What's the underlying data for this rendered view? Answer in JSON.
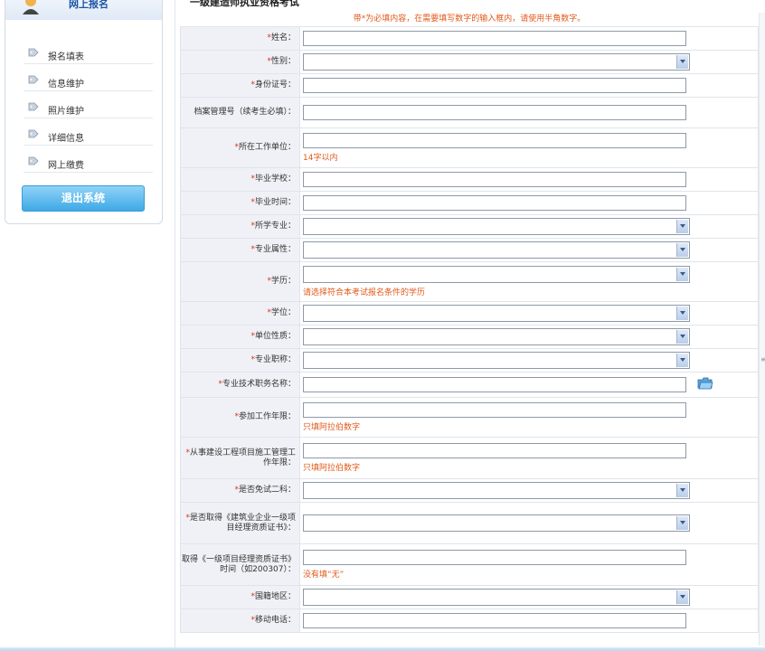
{
  "sidebar": {
    "title": "网上报名",
    "items": [
      {
        "label": "报名填表",
        "icon": "tag-icon"
      },
      {
        "label": "信息维护",
        "icon": "tag-icon"
      },
      {
        "label": "照片维护",
        "icon": "tag-icon"
      },
      {
        "label": "详细信息",
        "icon": "tag-icon"
      },
      {
        "label": "网上缴费",
        "icon": "tag-icon"
      }
    ],
    "logout_label": "退出系统"
  },
  "main": {
    "title": "一级建造师执业资格考试",
    "notice": "带*为必填内容，在需要填写数字的输入框内，请使用半角数字。"
  },
  "form": {
    "rows": [
      {
        "label": "姓名：",
        "required": true,
        "type": "text",
        "value": "",
        "hint": ""
      },
      {
        "label": "性别：",
        "required": true,
        "type": "select",
        "value": "",
        "hint": ""
      },
      {
        "label": "身份证号：",
        "required": true,
        "type": "text",
        "value": "",
        "hint": ""
      },
      {
        "label": "档案管理号（续考生必填）：",
        "required": false,
        "type": "text",
        "value": "",
        "hint": ""
      },
      {
        "label": "所在工作单位：",
        "required": true,
        "type": "text",
        "value": "",
        "hint": "14字以内"
      },
      {
        "label": "毕业学校：",
        "required": true,
        "type": "text",
        "value": "",
        "hint": ""
      },
      {
        "label": "毕业时间：",
        "required": true,
        "type": "text",
        "value": "",
        "hint": ""
      },
      {
        "label": "所学专业：",
        "required": true,
        "type": "select",
        "value": "",
        "hint": ""
      },
      {
        "label": "专业属性：",
        "required": true,
        "type": "select",
        "value": "",
        "hint": ""
      },
      {
        "label": "学历：",
        "required": true,
        "type": "select",
        "value": "",
        "hint": "请选择符合本考试报名条件的学历"
      },
      {
        "label": "学位：",
        "required": true,
        "type": "select",
        "value": "",
        "hint": ""
      },
      {
        "label": "单位性质：",
        "required": true,
        "type": "select",
        "value": "",
        "hint": ""
      },
      {
        "label": "专业职称：",
        "required": true,
        "type": "select",
        "value": "",
        "hint": ""
      },
      {
        "label": "专业技术职务名称：",
        "required": true,
        "type": "text",
        "value": "",
        "hint": "",
        "picker": true
      },
      {
        "label": "参加工作年限：",
        "required": true,
        "type": "text",
        "value": "",
        "hint": "只填阿拉伯数字"
      },
      {
        "label": "从事建设工程项目施工管理工作年限：",
        "required": true,
        "type": "text",
        "value": "",
        "hint": "只填阿拉伯数字"
      },
      {
        "label": "是否免试二科：",
        "required": true,
        "type": "select",
        "value": "",
        "hint": ""
      },
      {
        "label": "是否取得《建筑业企业一级项目经理资质证书》：",
        "required": true,
        "type": "select",
        "value": "",
        "hint": ""
      },
      {
        "label": "取得《一级项目经理资质证书》时间（如200307）：",
        "required": false,
        "type": "text",
        "value": "",
        "hint": "没有填“无”"
      },
      {
        "label": "国籍地区：",
        "required": true,
        "type": "select",
        "value": "",
        "hint": ""
      },
      {
        "label": "移动电话：",
        "required": true,
        "type": "text",
        "value": "",
        "hint": ""
      }
    ]
  },
  "colors": {
    "hint": "#e05a1a",
    "required": "#e03010",
    "label_bg": "#eff1f6",
    "button": "#3fa9e6"
  }
}
